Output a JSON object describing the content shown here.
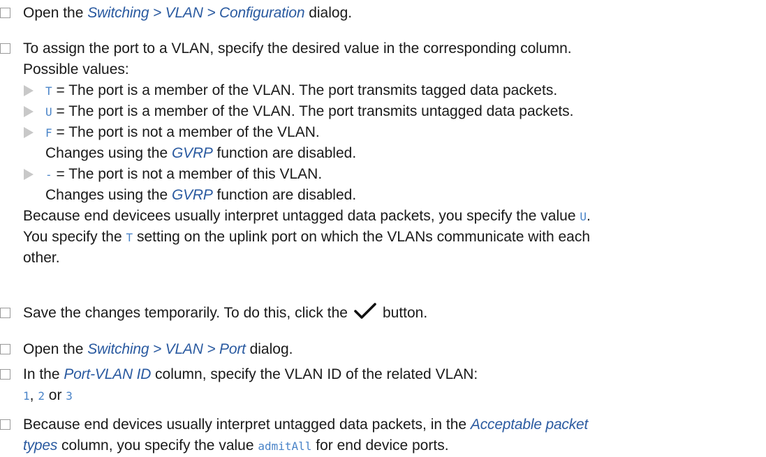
{
  "steps": [
    {
      "open": "Open the ",
      "path": "Switching > VLAN > Configuration",
      "close": " dialog."
    },
    {
      "line1": "To assign the port to a VLAN, specify the desired value in the corresponding column.",
      "line2": "Possible values:",
      "values": [
        {
          "code": "T",
          "text": " = The port is a member of the VLAN. The port transmits tagged data packets."
        },
        {
          "code": "U",
          "text": " = The port is a member of the VLAN. The port transmits untagged data packets."
        },
        {
          "code": "F",
          "text": " = The port is not a member of the VLAN.",
          "cont_pre": "Changes using the ",
          "cont_link": "GVRP",
          "cont_post": " function are disabled."
        },
        {
          "code": "-",
          "text": " = The port is not a member of this VLAN.",
          "cont_pre": "Changes using the ",
          "cont_link": "GVRP",
          "cont_post": " function are disabled."
        }
      ],
      "note1_pre": "Because end devicees usually interpret untagged data packets, you specify the value ",
      "note1_code": "U",
      "note1_post": ".",
      "note2_pre": "You specify the ",
      "note2_code": "T",
      "note2_post": " setting on the uplink port on which the VLANs communicate with each",
      "note3": "other."
    },
    {
      "pre": "Save the changes temporarily. To do this, click the",
      "icon": "checkmark-icon",
      "post": "button."
    },
    {
      "open": "Open the ",
      "path": "Switching > VLAN > Port",
      "close": " dialog."
    },
    {
      "pre": "In the ",
      "column": "Port-VLAN ID",
      "post": " column, specify the VLAN ID of the related VLAN:",
      "v1": "1",
      "sep1": ", ",
      "v2": "2",
      "sep2": " or ",
      "v3": "3"
    },
    {
      "pre": "Because end devices usually interpret untagged data packets, in the ",
      "column_a": "Acceptable packet",
      "column_b": "types",
      "mid": " column, you specify the value ",
      "code": "admitAll",
      "post": " for end device ports."
    }
  ],
  "colors": {
    "nav_link": "#2a5aa0",
    "code": "#4a84c8",
    "checkbox_border": "#9a9a9a",
    "bullet": "#c8c8c8"
  }
}
